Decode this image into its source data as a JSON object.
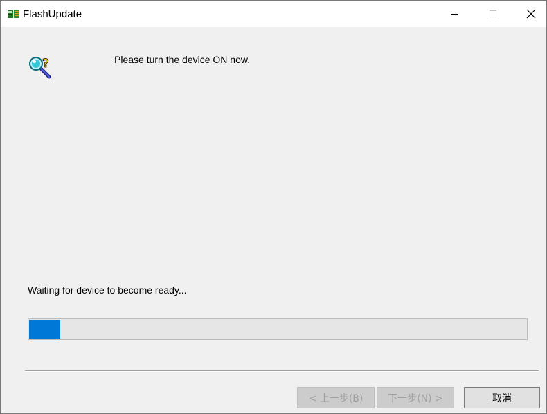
{
  "window": {
    "title": "FlashUpdate",
    "controls": {
      "minimize_icon": "minimize-icon",
      "maximize_icon": "maximize-icon",
      "close_icon": "close-icon"
    }
  },
  "main": {
    "prompt": "Please turn the device ON now.",
    "status": "Waiting for device to become ready...",
    "progress_percent": 6.5,
    "icon": "search-help-icon"
  },
  "buttons": {
    "back_label": "< 上一步(B)",
    "next_label": "下一步(N) >",
    "cancel_label": "取消"
  },
  "colors": {
    "progress_fill": "#0078d7",
    "background": "#f0f0f0"
  }
}
